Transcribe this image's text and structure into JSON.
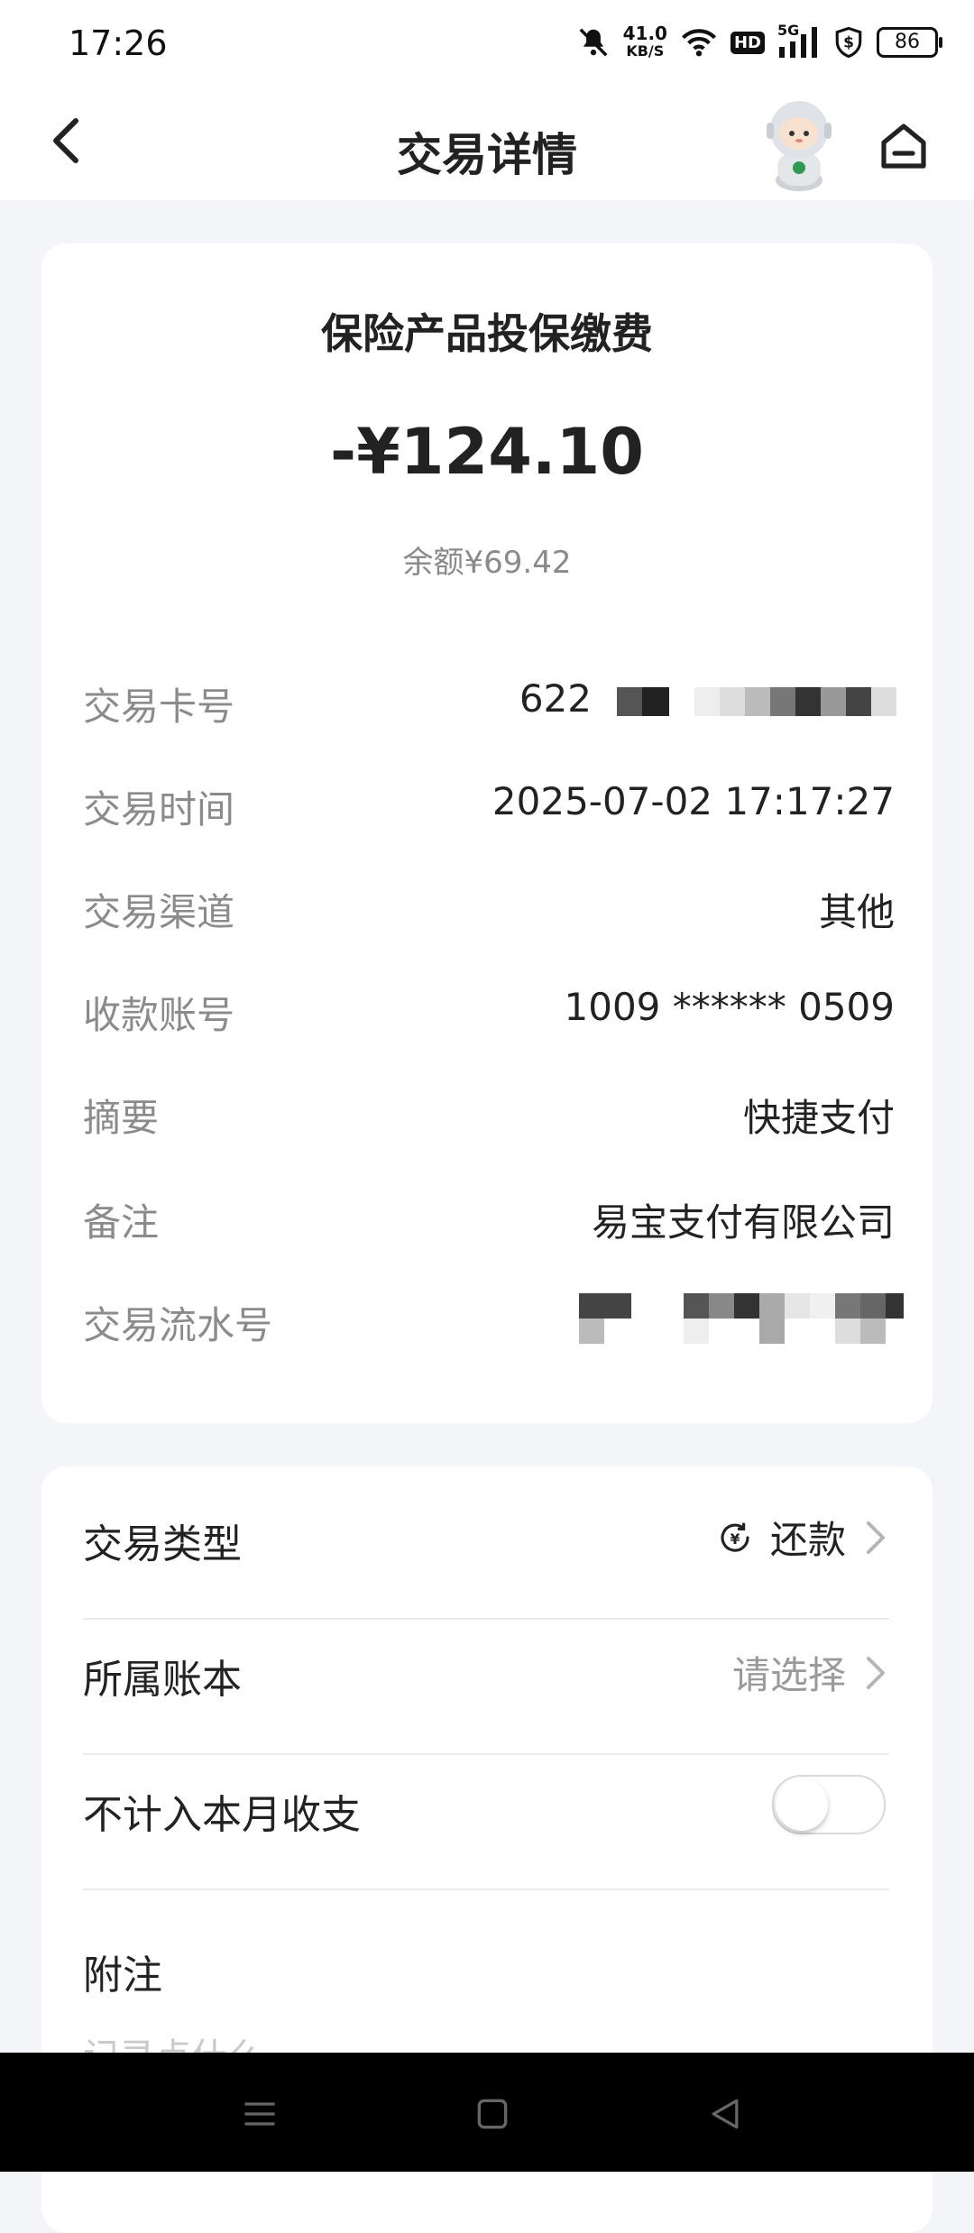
{
  "status_bar": {
    "time": "17:26",
    "net_speed_value": "41.0",
    "net_speed_unit": "KB/S",
    "hd_label": "HD",
    "signal_label": "5G",
    "battery": "86"
  },
  "header": {
    "title": "交易详情"
  },
  "summary": {
    "title": "保险产品投保缴费",
    "amount": "-¥124.10",
    "balance": "余额¥69.42"
  },
  "details": [
    {
      "label": "交易卡号",
      "value": "622"
    },
    {
      "label": "交易时间",
      "value": "2025-07-02 17:17:27"
    },
    {
      "label": "交易渠道",
      "value": "其他"
    },
    {
      "label": "收款账号",
      "value": "1009 ****** 0509"
    },
    {
      "label": "摘要",
      "value": "快捷支付"
    },
    {
      "label": "备注",
      "value": "易宝支付有限公司"
    },
    {
      "label": "交易流水号",
      "value": ""
    }
  ],
  "settings": {
    "type_label": "交易类型",
    "type_value": "还款",
    "book_label": "所属账本",
    "book_placeholder": "请选择",
    "exclude_label": "不计入本月收支",
    "exclude_on": false,
    "note_label": "附注",
    "note_placeholder": "记录点什么"
  },
  "colors": {
    "background": "#f4f5f9",
    "card": "#ffffff",
    "label_gray": "#8b8b8b",
    "text_dark": "#222222"
  }
}
